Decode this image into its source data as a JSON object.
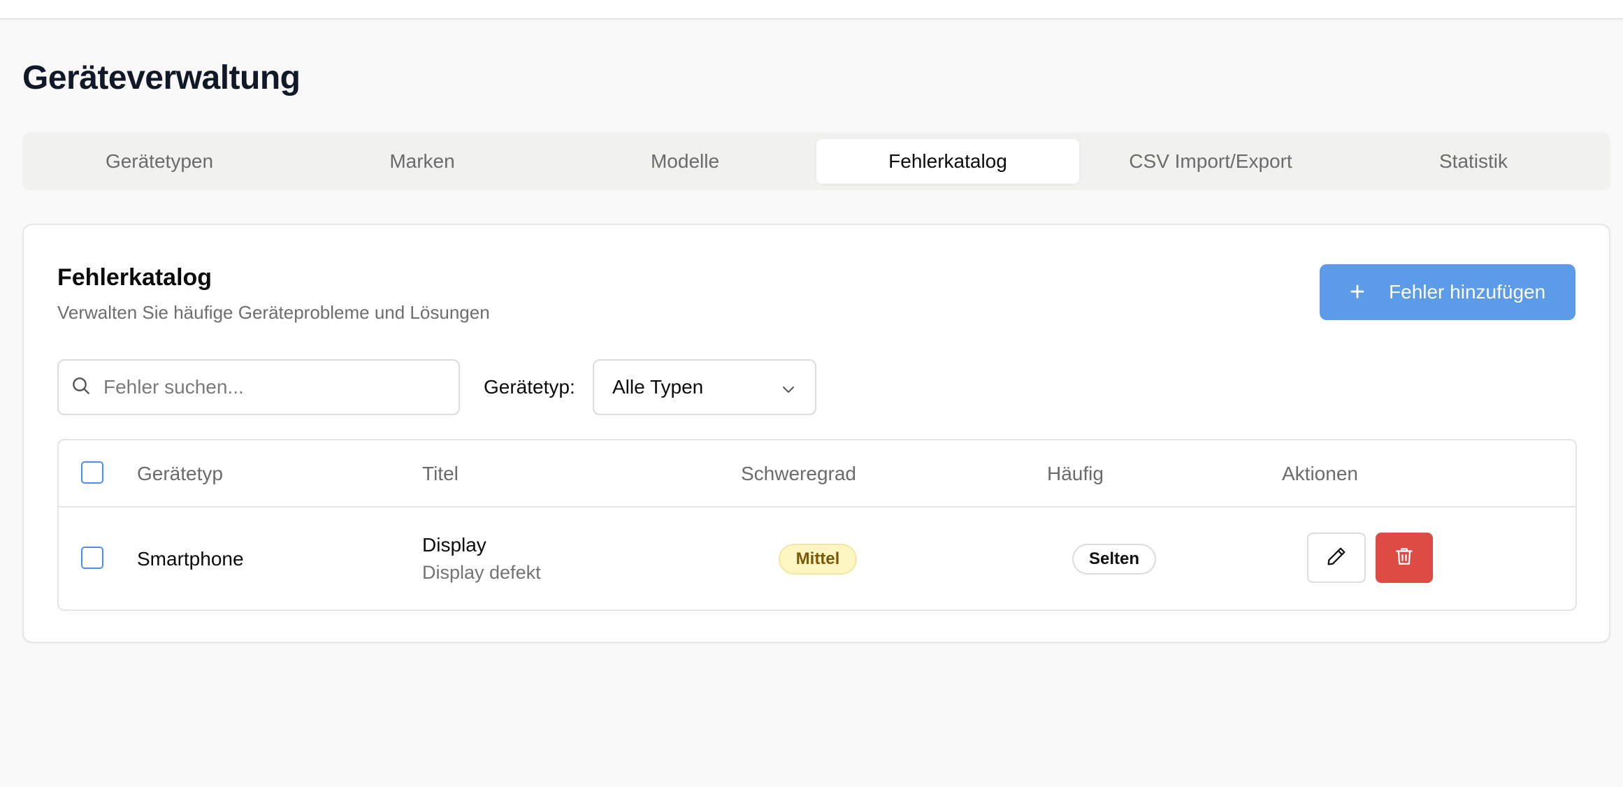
{
  "page": {
    "title": "Geräteverwaltung"
  },
  "tabs": [
    {
      "label": "Gerätetypen",
      "active": false
    },
    {
      "label": "Marken",
      "active": false
    },
    {
      "label": "Modelle",
      "active": false
    },
    {
      "label": "Fehlerkatalog",
      "active": true
    },
    {
      "label": "CSV Import/Export",
      "active": false
    },
    {
      "label": "Statistik",
      "active": false
    }
  ],
  "card": {
    "title": "Fehlerkatalog",
    "subtitle": "Verwalten Sie häufige Geräteprobleme und Lösungen",
    "add_button": {
      "icon": "plus-icon",
      "label": "Fehler hinzufügen"
    }
  },
  "filters": {
    "search": {
      "placeholder": "Fehler suchen...",
      "value": "",
      "icon": "search-icon"
    },
    "device_type_label": "Gerätetyp:",
    "device_type_value": "Alle Typen"
  },
  "table": {
    "columns": [
      "Gerätetyp",
      "Titel",
      "Schweregrad",
      "Häufig",
      "Aktionen"
    ],
    "rows": [
      {
        "checked": false,
        "device_type": "Smartphone",
        "title": "Display",
        "description": "Display defekt",
        "severity": "Mittel",
        "frequency": "Selten",
        "actions": [
          "edit-icon",
          "trash-icon"
        ]
      }
    ]
  },
  "colors": {
    "primary": "#5b9be8",
    "danger": "#de4b45",
    "severity_medium_bg": "#fdf6c3",
    "severity_medium_text": "#7a5a0a",
    "checkbox_border": "#4a8ff0"
  }
}
